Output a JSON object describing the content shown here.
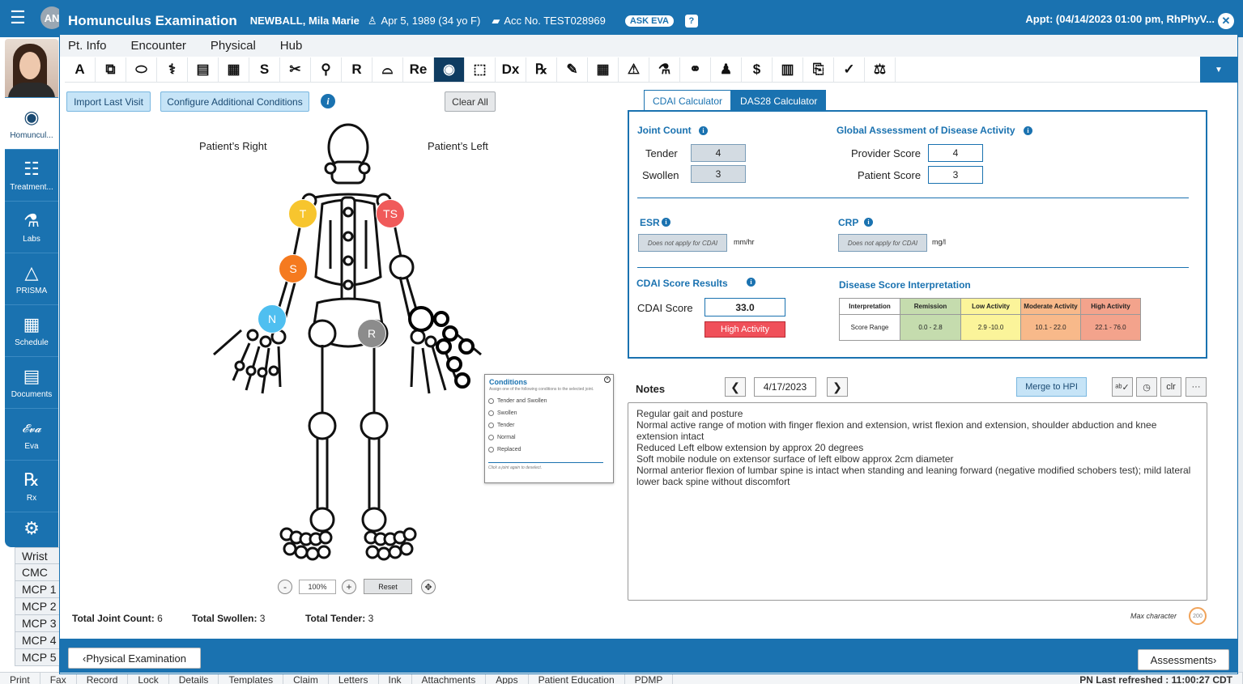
{
  "header": {
    "title": "Homunculus Examination",
    "patient": "NEWBALL, Mila Marie",
    "dob": "Apr 5, 1989 (34 yo F)",
    "acc": "Acc No. TEST028969",
    "ask_eva": "ASK EVA",
    "help": "?",
    "appt": "Appt: (04/14/2023 01:00 pm, RhPhyV...",
    "avatar_initials": "AN"
  },
  "menu": [
    "Pt. Info",
    "Encounter",
    "Physical",
    "Hub"
  ],
  "toolbar": {
    "icons": [
      "allergy-icon",
      "documents-icon",
      "medication-icon",
      "dna-icon",
      "chart-icon",
      "building-icon",
      "s-icon",
      "tools-icon",
      "vial-icon",
      "r-icon",
      "glasses-icon",
      "re-icon",
      "homunculus-icon",
      "pill-bottle-icon",
      "dx-icon",
      "rx-icon",
      "pen-icon",
      "table-icon",
      "clipboard-icon",
      "flask-icon",
      "kidney-icon",
      "bell-icon",
      "dollar-icon",
      "id-card-icon",
      "copy-icon",
      "stamp-icon",
      "scale-icon"
    ],
    "labels": [
      "A",
      "⧉",
      "⬭",
      "⚕",
      "▤",
      "▦",
      "S",
      "✂",
      "⚲",
      "R",
      "⌓",
      "Re",
      "◉",
      "⬚",
      "Dx",
      "℞",
      "✎",
      "▦",
      "⚠",
      "⚗",
      "⚭",
      "♟",
      "$",
      "▥",
      "⎘",
      "✓",
      "⚖"
    ],
    "active_index": 12
  },
  "sidenav": [
    {
      "label": "Homuncul...",
      "icon": "homunculus-icon",
      "glyph": "◉"
    },
    {
      "label": "Treatment...",
      "icon": "sliders-icon",
      "glyph": "☷"
    },
    {
      "label": "Labs",
      "icon": "flask-icon",
      "glyph": "⚗"
    },
    {
      "label": "PRISMA",
      "icon": "triangle-icon",
      "glyph": "△"
    },
    {
      "label": "Schedule",
      "icon": "calendar-icon",
      "glyph": "▦"
    },
    {
      "label": "Documents",
      "icon": "document-icon",
      "glyph": "▤"
    },
    {
      "label": "Eva",
      "icon": "eva-icon",
      "glyph": "𝓔𝓿𝓪"
    },
    {
      "label": "Rx",
      "icon": "rx-icon",
      "glyph": "℞"
    },
    {
      "label": "",
      "icon": "gear-icon",
      "glyph": "⚙"
    }
  ],
  "left": {
    "import_btn": "Import Last Visit",
    "configure_btn": "Configure Additional Conditions",
    "clear_btn": "Clear All",
    "patient_right": "Patient’s Right",
    "patient_left": "Patient’s Left",
    "joints": [
      {
        "label": "T",
        "color": "#f7c52e"
      },
      {
        "label": "TS",
        "color": "#f05a5a"
      },
      {
        "label": "S",
        "color": "#f57a1f"
      },
      {
        "label": "N",
        "color": "#4fbff0"
      },
      {
        "label": "R",
        "color": "#8c8c8c"
      }
    ],
    "zoom_minus": "-",
    "zoom_plus": "+",
    "zoom_value": "100%",
    "reset": "Reset",
    "total_joint_label": "Total Joint Count:",
    "total_joint_value": "6",
    "total_swollen_label": "Total Swollen:",
    "total_swollen_value": "3",
    "total_tender_label": "Total Tender:",
    "total_tender_value": "3"
  },
  "conditions_popup": {
    "title": "Conditions",
    "subtitle": "Assign one of the following conditions to the selected joint.",
    "options": [
      "Tender and Swollen",
      "Swollen",
      "Tender",
      "Normal",
      "Replaced"
    ],
    "footer": "Click a joint again to deselect."
  },
  "calc": {
    "tab_cdai": "CDAI Calculator",
    "tab_das28": "DAS28 Calculator",
    "joint_count_title": "Joint Count",
    "tender_label": "Tender",
    "tender_value": "4",
    "swollen_label": "Swollen",
    "swollen_value": "3",
    "global_title": "Global Assessment of Disease Activity",
    "provider_label": "Provider Score",
    "provider_value": "4",
    "patient_label": "Patient Score",
    "patient_value": "3",
    "esr_title": "ESR",
    "esr_placeholder": "Does not apply for CDAI",
    "esr_unit": "mm/hr",
    "crp_title": "CRP",
    "crp_placeholder": "Does not apply for CDAI",
    "crp_unit": "mg/l",
    "results_title": "CDAI Score Results",
    "cdai_label": "CDAI Score",
    "cdai_value": "33.0",
    "cdai_badge": "High Activity",
    "interp_title": "Disease Score Interpretation",
    "interp_headers": [
      "Interpretation",
      "Remission",
      "Low Activity",
      "Moderate Activity",
      "High Activity"
    ],
    "interp_row": [
      "Score Range",
      "0.0 - 2.8",
      "2.9 -10.0",
      "10.1 - 22.0",
      "22.1 - 76.0"
    ],
    "interp_colors": [
      "#ffffff",
      "#c5dcae",
      "#fbf49a",
      "#f8b98a",
      "#f3a38c"
    ]
  },
  "notes": {
    "title": "Notes",
    "date": "4/17/2023",
    "merge": "Merge to HPI",
    "clr": "clr",
    "more": "···",
    "lines": [
      "Regular gait and posture",
      "Normal active range of motion with finger flexion and extension, wrist flexion and extension, shoulder abduction and knee extension intact",
      "Reduced Left elbow extension by approx 20 degrees",
      "Soft mobile nodule on extensor surface of left elbow approx 2cm diameter",
      "Normal anterior flexion of lumbar spine is intact when standing and leaning forward (negative modified schobers test); mild lateral lower back spine without discomfort"
    ],
    "max_label": "Max character",
    "max_value": "200"
  },
  "footer": {
    "prev": "Physical Examination",
    "next": "Assessments"
  },
  "background": {
    "table_rows": [
      "Wrist",
      "CMC",
      "MCP 1",
      "MCP 2",
      "MCP 3",
      "MCP 4",
      "MCP 5"
    ],
    "bottom_bar": [
      "Print",
      "Fax",
      "Record",
      "Lock",
      "Details",
      "Templates",
      "Claim",
      "Letters",
      "Ink",
      "Attachments",
      "Apps",
      "Patient Education",
      "PDMP"
    ],
    "status": "PN Last refreshed : 11:00:27 CDT"
  }
}
